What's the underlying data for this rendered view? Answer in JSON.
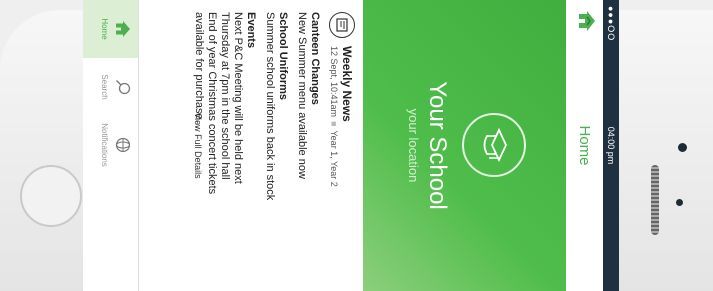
{
  "status": {
    "carrier": "●●●OO",
    "time": "04:00 pm"
  },
  "header": {
    "title": "Home",
    "logo_icon": "school-home-icon"
  },
  "hero": {
    "school_name": "Your School",
    "location": "your location",
    "badge_icon": "graduation-cap-icon"
  },
  "news": {
    "title": "Weekly News",
    "date": "12 Sept, 10:41am",
    "years": "Year 1, Year 2",
    "items": [
      {
        "heading": "Canteen Changes",
        "body": "New Summer menu available now"
      },
      {
        "heading": "School Uniforms",
        "body": "Summer school uniforms back in stock"
      },
      {
        "heading": "Events",
        "lines": [
          "Next P&C Meeting will be held next",
          "Thursday at 7pm in the school hall",
          "End of year Christmas concert tickets",
          "available for purchase..."
        ]
      }
    ],
    "details_label": "View Full Details"
  },
  "tabs": [
    {
      "label": "Home",
      "icon": "home-icon"
    },
    {
      "label": "Search",
      "icon": "search-icon"
    },
    {
      "label": "Notifications",
      "icon": "globe-icon"
    }
  ],
  "colors": {
    "accent": "#4caf50",
    "statusbar": "#1f3040"
  }
}
